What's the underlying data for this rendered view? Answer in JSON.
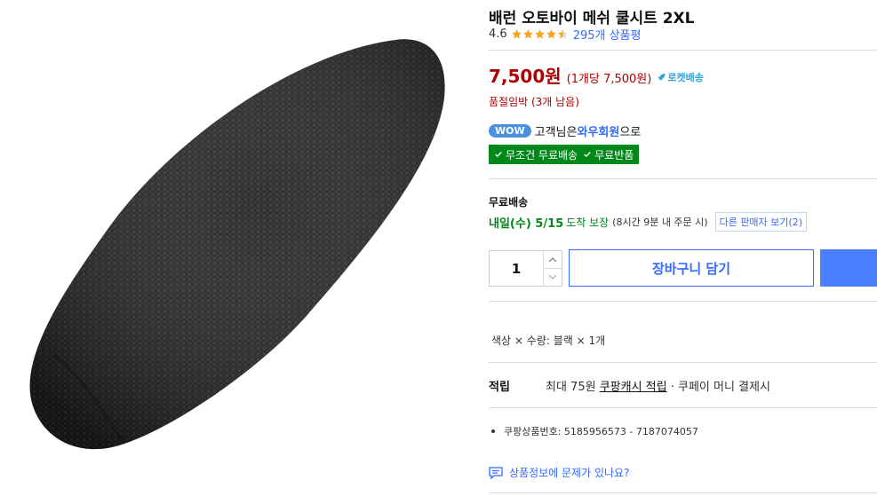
{
  "product": {
    "title": "배런 오토바이 메쉬 쿨시트 2XL",
    "rating": "4.6",
    "stars": 4.5,
    "reviews_label": "295개 상품평"
  },
  "price": {
    "amount": "7,500원",
    "unit": "(1개당 7,500원)",
    "rocket_label": "로켓배송",
    "stock_text": "품절임박 (3개 남음)"
  },
  "wow": {
    "badge": "WOW",
    "prefix": "고객님은 ",
    "member": "와우회원",
    "suffix": "으로",
    "benefit1": "무조건 무료배송",
    "benefit2": "무료반품"
  },
  "shipping": {
    "title": "무료배송",
    "date": "내일(수) 5/15",
    "date_suffix": "도착 보장",
    "note": "(8시간 9분 내 주문 시)",
    "other_seller": "다른 판매자 보기(2)"
  },
  "purchase": {
    "quantity": "1",
    "cart_label": "장바구니 담기"
  },
  "option": {
    "text": "색상 × 수량: 블랙 × 1개"
  },
  "cash": {
    "label": "적립",
    "prefix": "최대 75원 ",
    "link": "쿠팡캐시 적립",
    "suffix": " · 쿠페이 머니 결제시"
  },
  "details": {
    "product_no": "쿠팡상품번호: 5185956573 - 7187074057",
    "report": "상품정보에 문제가 있나요?"
  },
  "colors": {
    "price_red": "#ae0000",
    "link_blue": "#346aff",
    "green": "#00891a",
    "star": "#f5a623"
  },
  "icons": {
    "star": "star-icon",
    "rocket": "rocket-icon",
    "check": "check-icon",
    "up": "chevron-up-icon",
    "down": "chevron-down-icon",
    "report": "chat-report-icon"
  }
}
